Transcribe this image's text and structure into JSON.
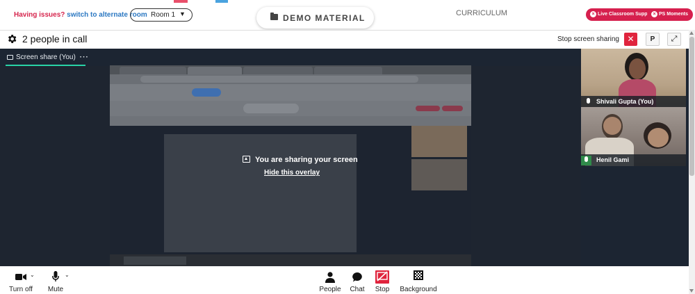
{
  "topbar": {
    "issue_prefix": "Having issues?",
    "issue_link": "switch to alternate room",
    "room_value": "Room 1",
    "demo_material": "DEMO MATERIAL",
    "curriculum": "CURRICULUM",
    "live_support": "Live Classroom Support",
    "ps_moments": "PS Moments"
  },
  "call": {
    "people_count": "2 people in call",
    "stop_sharing": "Stop screen sharing",
    "p_label": "P"
  },
  "stage": {
    "share_tab": "Screen share (You)",
    "overlay_title": "You are sharing your screen",
    "overlay_hide": "Hide this overlay"
  },
  "participants": [
    {
      "name": "Shivali Gupta (You)"
    },
    {
      "name": "Henil Gami"
    }
  ],
  "toolbar": {
    "turn_off": "Turn off",
    "mute": "Mute",
    "people": "People",
    "chat": "Chat",
    "stop": "Stop",
    "background": "Background"
  },
  "colors": {
    "accent_red": "#d6204e",
    "link_blue": "#2b78c2",
    "stage_bg": "#1c2532",
    "active_tab_underline": "#29d3a6",
    "stop_button_red": "#e0243d"
  }
}
